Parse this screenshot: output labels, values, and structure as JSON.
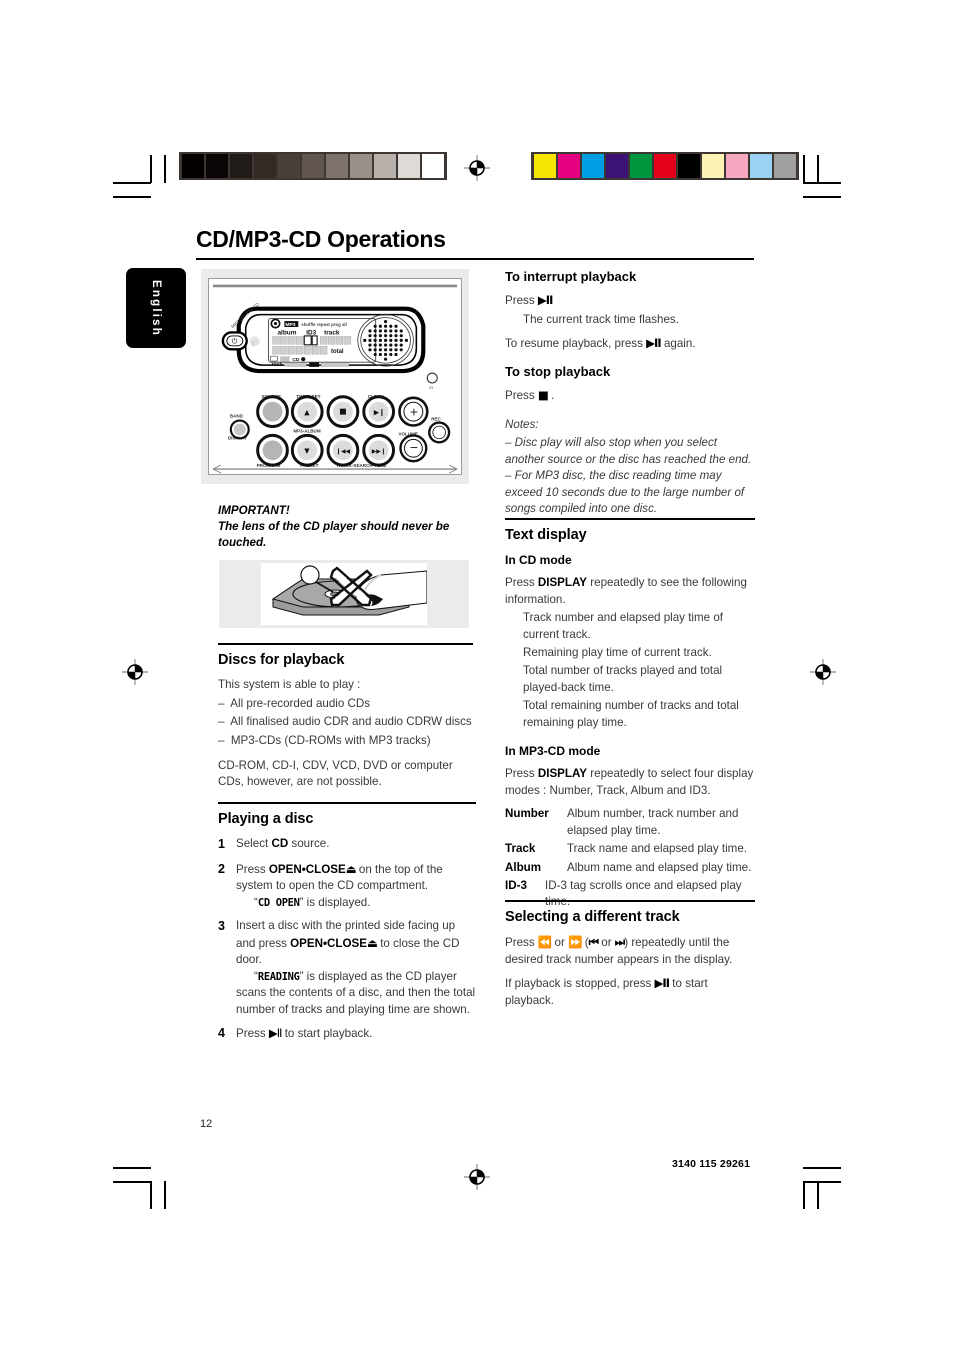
{
  "document": {
    "page_title": "CD/MP3-CD Operations",
    "language_tab": "English",
    "page_number": "12",
    "footer_code": "3140 115 29261"
  },
  "calibration": {
    "grayscale": [
      "#050000",
      "#0b0605",
      "#221c19",
      "#332a26",
      "#4a403b",
      "#61564f",
      "#7d726c",
      "#99908b",
      "#b8b0aa",
      "#dedad5",
      "#ffffff"
    ],
    "color": [
      "#f5e500",
      "#e4007f",
      "#009fe3",
      "#3d1277",
      "#009640",
      "#e3001b",
      "#000000",
      "#fcf3b5",
      "#f7a8c0",
      "#9ad3f2",
      "#a0a0a0"
    ]
  },
  "figures": {
    "device": {
      "alt": "Top panel of the CD/MP3 audio system with LCD display and buttons",
      "display_labels": [
        "MP3",
        "shuffle",
        "repeat",
        "prog",
        "all",
        "album",
        "ID3",
        "track",
        "total",
        "CD",
        "rock"
      ],
      "button_labels": [
        "SOURCE",
        "TIMER SET",
        "CLOCK",
        "BAND",
        "MP3-ALBUM",
        "REC",
        "VOLUME",
        "DISPLAY",
        "PROGRAM",
        "PRESET",
        "TRACK-SEARCH-TUNE"
      ]
    },
    "lens": {
      "alt": "Do not touch the lens of the CD player - hand with crossed-out marking"
    }
  },
  "left_column": {
    "important": {
      "heading": "IMPORTANT!",
      "body": "The lens of the CD player should never be touched."
    },
    "discs": {
      "heading": "Discs for playback",
      "intro": "This system is able to play :",
      "items": [
        "All pre-recorded audio CDs",
        "All finalised audio CDR and audio CDRW discs",
        "MP3-CDs (CD-ROMs with MP3 tracks)"
      ],
      "closing": "CD-ROM, CD-I, CDV, VCD, DVD or computer CDs, however, are not possible."
    },
    "playing": {
      "heading": "Playing a disc",
      "steps": [
        {
          "num": "1",
          "text_a": "Select ",
          "bold_a": "CD",
          "text_b": " source.",
          "sub": ""
        },
        {
          "num": "2",
          "text_a": "Press ",
          "bold_a": "OPEN•CLOSE",
          "glyph": "⏏",
          "text_b": " on the top of the system to open the CD compartment.",
          "sub_pre": "“",
          "sub_lcd": "CD OPEN",
          "sub_post": "” is displayed."
        },
        {
          "num": "3",
          "text_a": "Insert a disc with the printed side facing up and press ",
          "bold_a": "OPEN•CLOSE",
          "glyph": "⏏",
          "text_b": " to close the CD door.",
          "sub_pre": "“",
          "sub_lcd": "READING",
          "sub_post": "” is displayed as the CD player scans the contents of a disc, and then the total number of tracks and playing time are shown."
        },
        {
          "num": "4",
          "text_a": "Press ",
          "glyph": "▶Ⅱ",
          "text_b": " to start playback.",
          "sub": ""
        }
      ]
    }
  },
  "right_column": {
    "interrupt": {
      "heading": "To interrupt playback",
      "press_label": "Press",
      "press_glyph": "▶Ⅱ",
      "result": "The current track time flashes.",
      "resume_a": "To resume playback, press",
      "resume_glyph": "▶Ⅱ",
      "resume_b": "again."
    },
    "stop": {
      "heading": "To stop playback",
      "press_label": "Press",
      "press_glyph": "■",
      "period": "."
    },
    "notes": {
      "heading": "Notes:",
      "items": [
        "–  Disc play will also stop when you select another source or the disc has reached the end.",
        "–  For MP3 disc, the disc reading time may exceed 10 seconds due to the large number of songs compiled into one disc."
      ]
    },
    "text_display": {
      "heading": "Text display",
      "cd_mode": {
        "subheading": "In CD mode",
        "intro_a": "Press ",
        "intro_bold": "DISPLAY",
        "intro_b": " repeatedly to see the following information.",
        "items": [
          "Track number and elapsed play time of current track.",
          "Remaining play time of current track.",
          "Total number of tracks played and total played-back time.",
          "Total remaining number of tracks and total remaining play time."
        ]
      },
      "mp3_mode": {
        "subheading": "In MP3-CD mode",
        "intro_a": "Press ",
        "intro_bold": "DISPLAY",
        "intro_b": " repeatedly to select four display modes : Number, Track, Album and ID3.",
        "definitions": [
          {
            "term": "Number",
            "desc": "Album number, track number and elapsed play time."
          },
          {
            "term": "Track",
            "desc": "Track name and elapsed play time."
          },
          {
            "term": "Album",
            "desc": "Album name and elapsed play time."
          },
          {
            "term": "ID-3",
            "desc": "ID-3 tag scrolls once and elapsed play time."
          }
        ]
      }
    },
    "selecting_track": {
      "heading": "Selecting a different track",
      "line1_a": "Press ",
      "glyph_prev": "⏪",
      "line1_or": " or ",
      "glyph_next": "⏩",
      "line1_b": " (",
      "glyph_prev_small": "⏮",
      "line1_or2": " or ",
      "glyph_next_small": "⏭",
      "line1_c": ") repeatedly until the desired track number appears in the display.",
      "line2_a": "If playback is stopped, press ",
      "line2_glyph": "▶Ⅱ",
      "line2_b": " to start playback."
    }
  }
}
